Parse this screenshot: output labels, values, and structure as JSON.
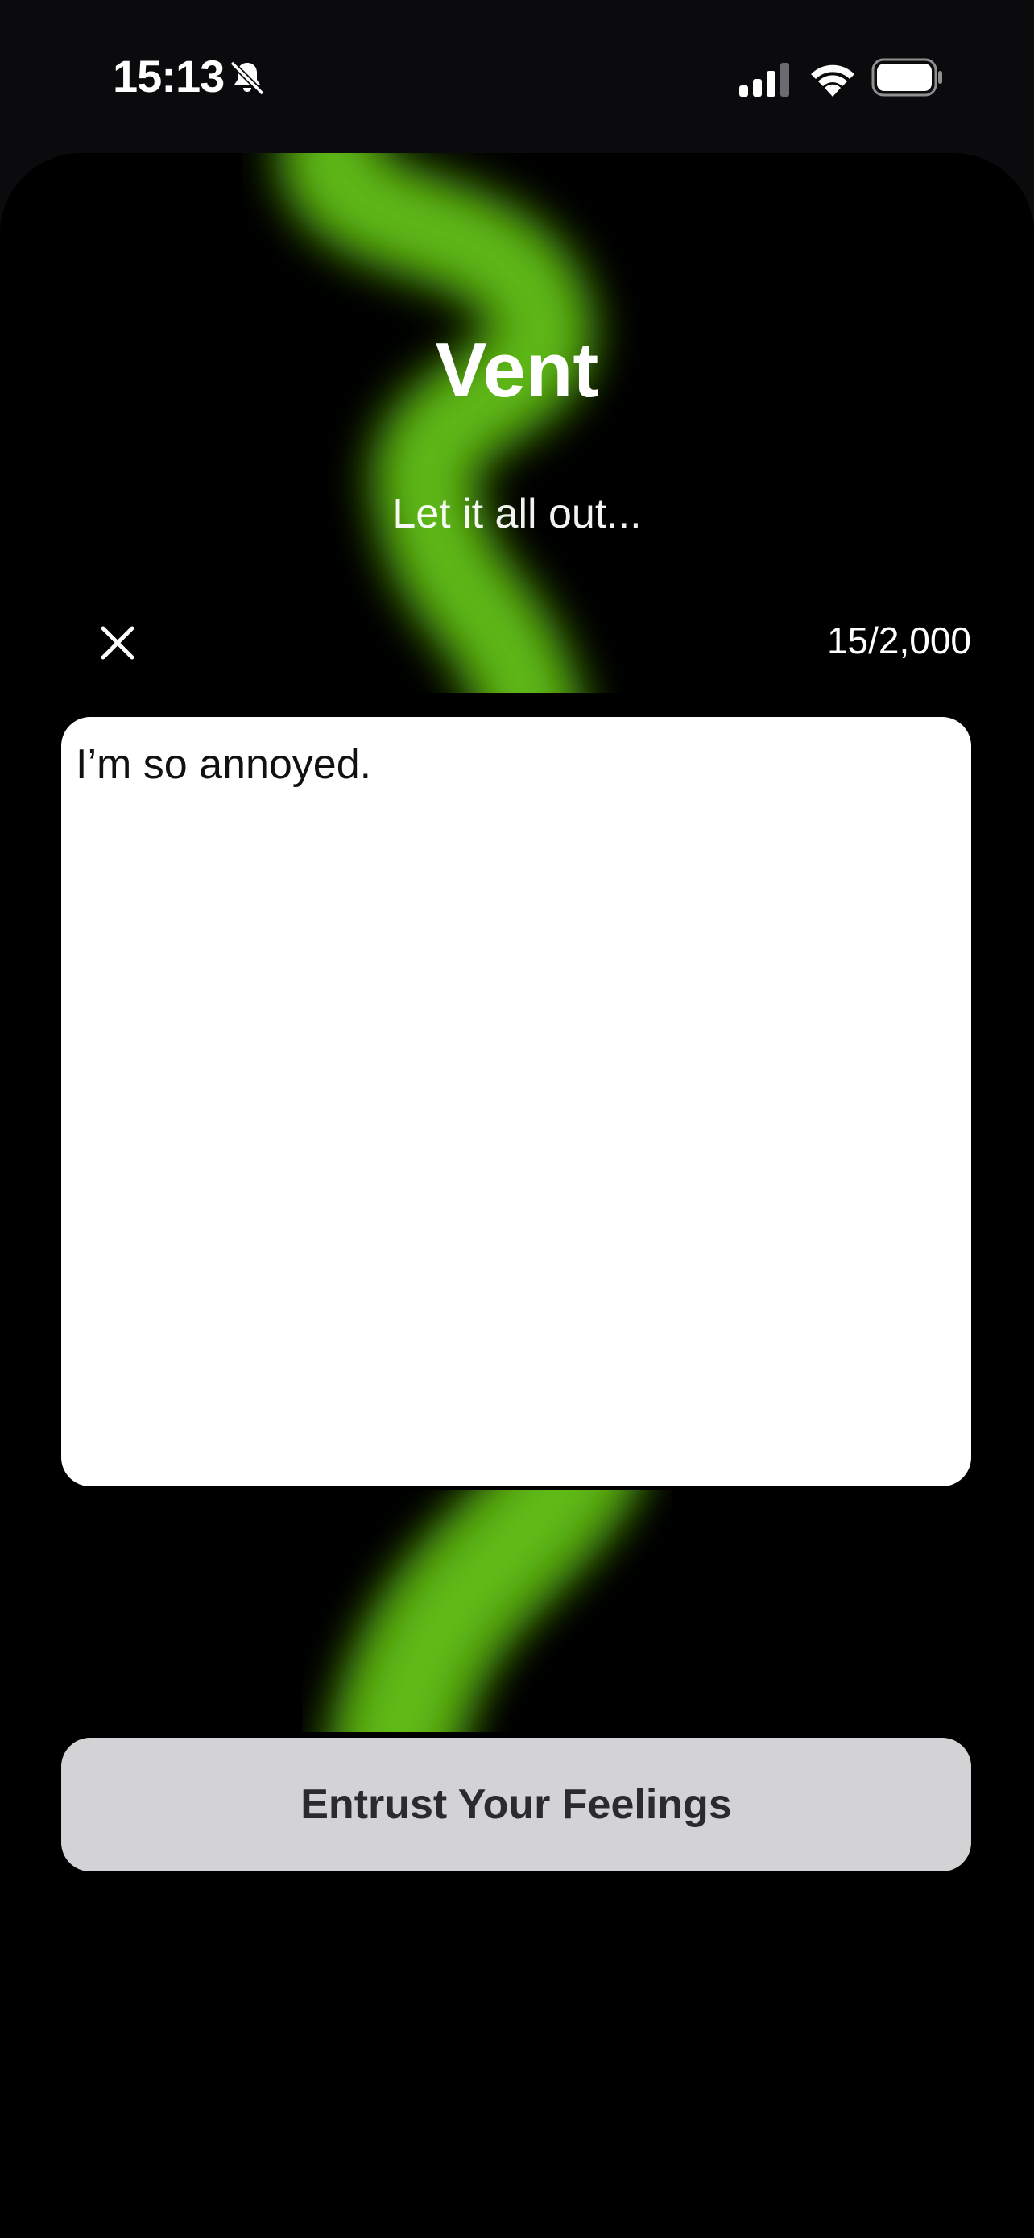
{
  "status_bar": {
    "time": "15:13",
    "icons": [
      "bell-slash-icon",
      "cellular-signal-icon",
      "wifi-icon",
      "battery-icon"
    ]
  },
  "header": {
    "title": "Vent",
    "subtitle": "Let it all out..."
  },
  "editor": {
    "close_icon": "close-icon",
    "counter": "15/2,000",
    "text": "I’m so annoyed."
  },
  "actions": {
    "submit_label": "Entrust Your Feelings"
  },
  "colors": {
    "background": "#000000",
    "accent_green": "#5fbf14",
    "button_bg": "#d3d3d6",
    "button_text": "#2b2b2e"
  }
}
